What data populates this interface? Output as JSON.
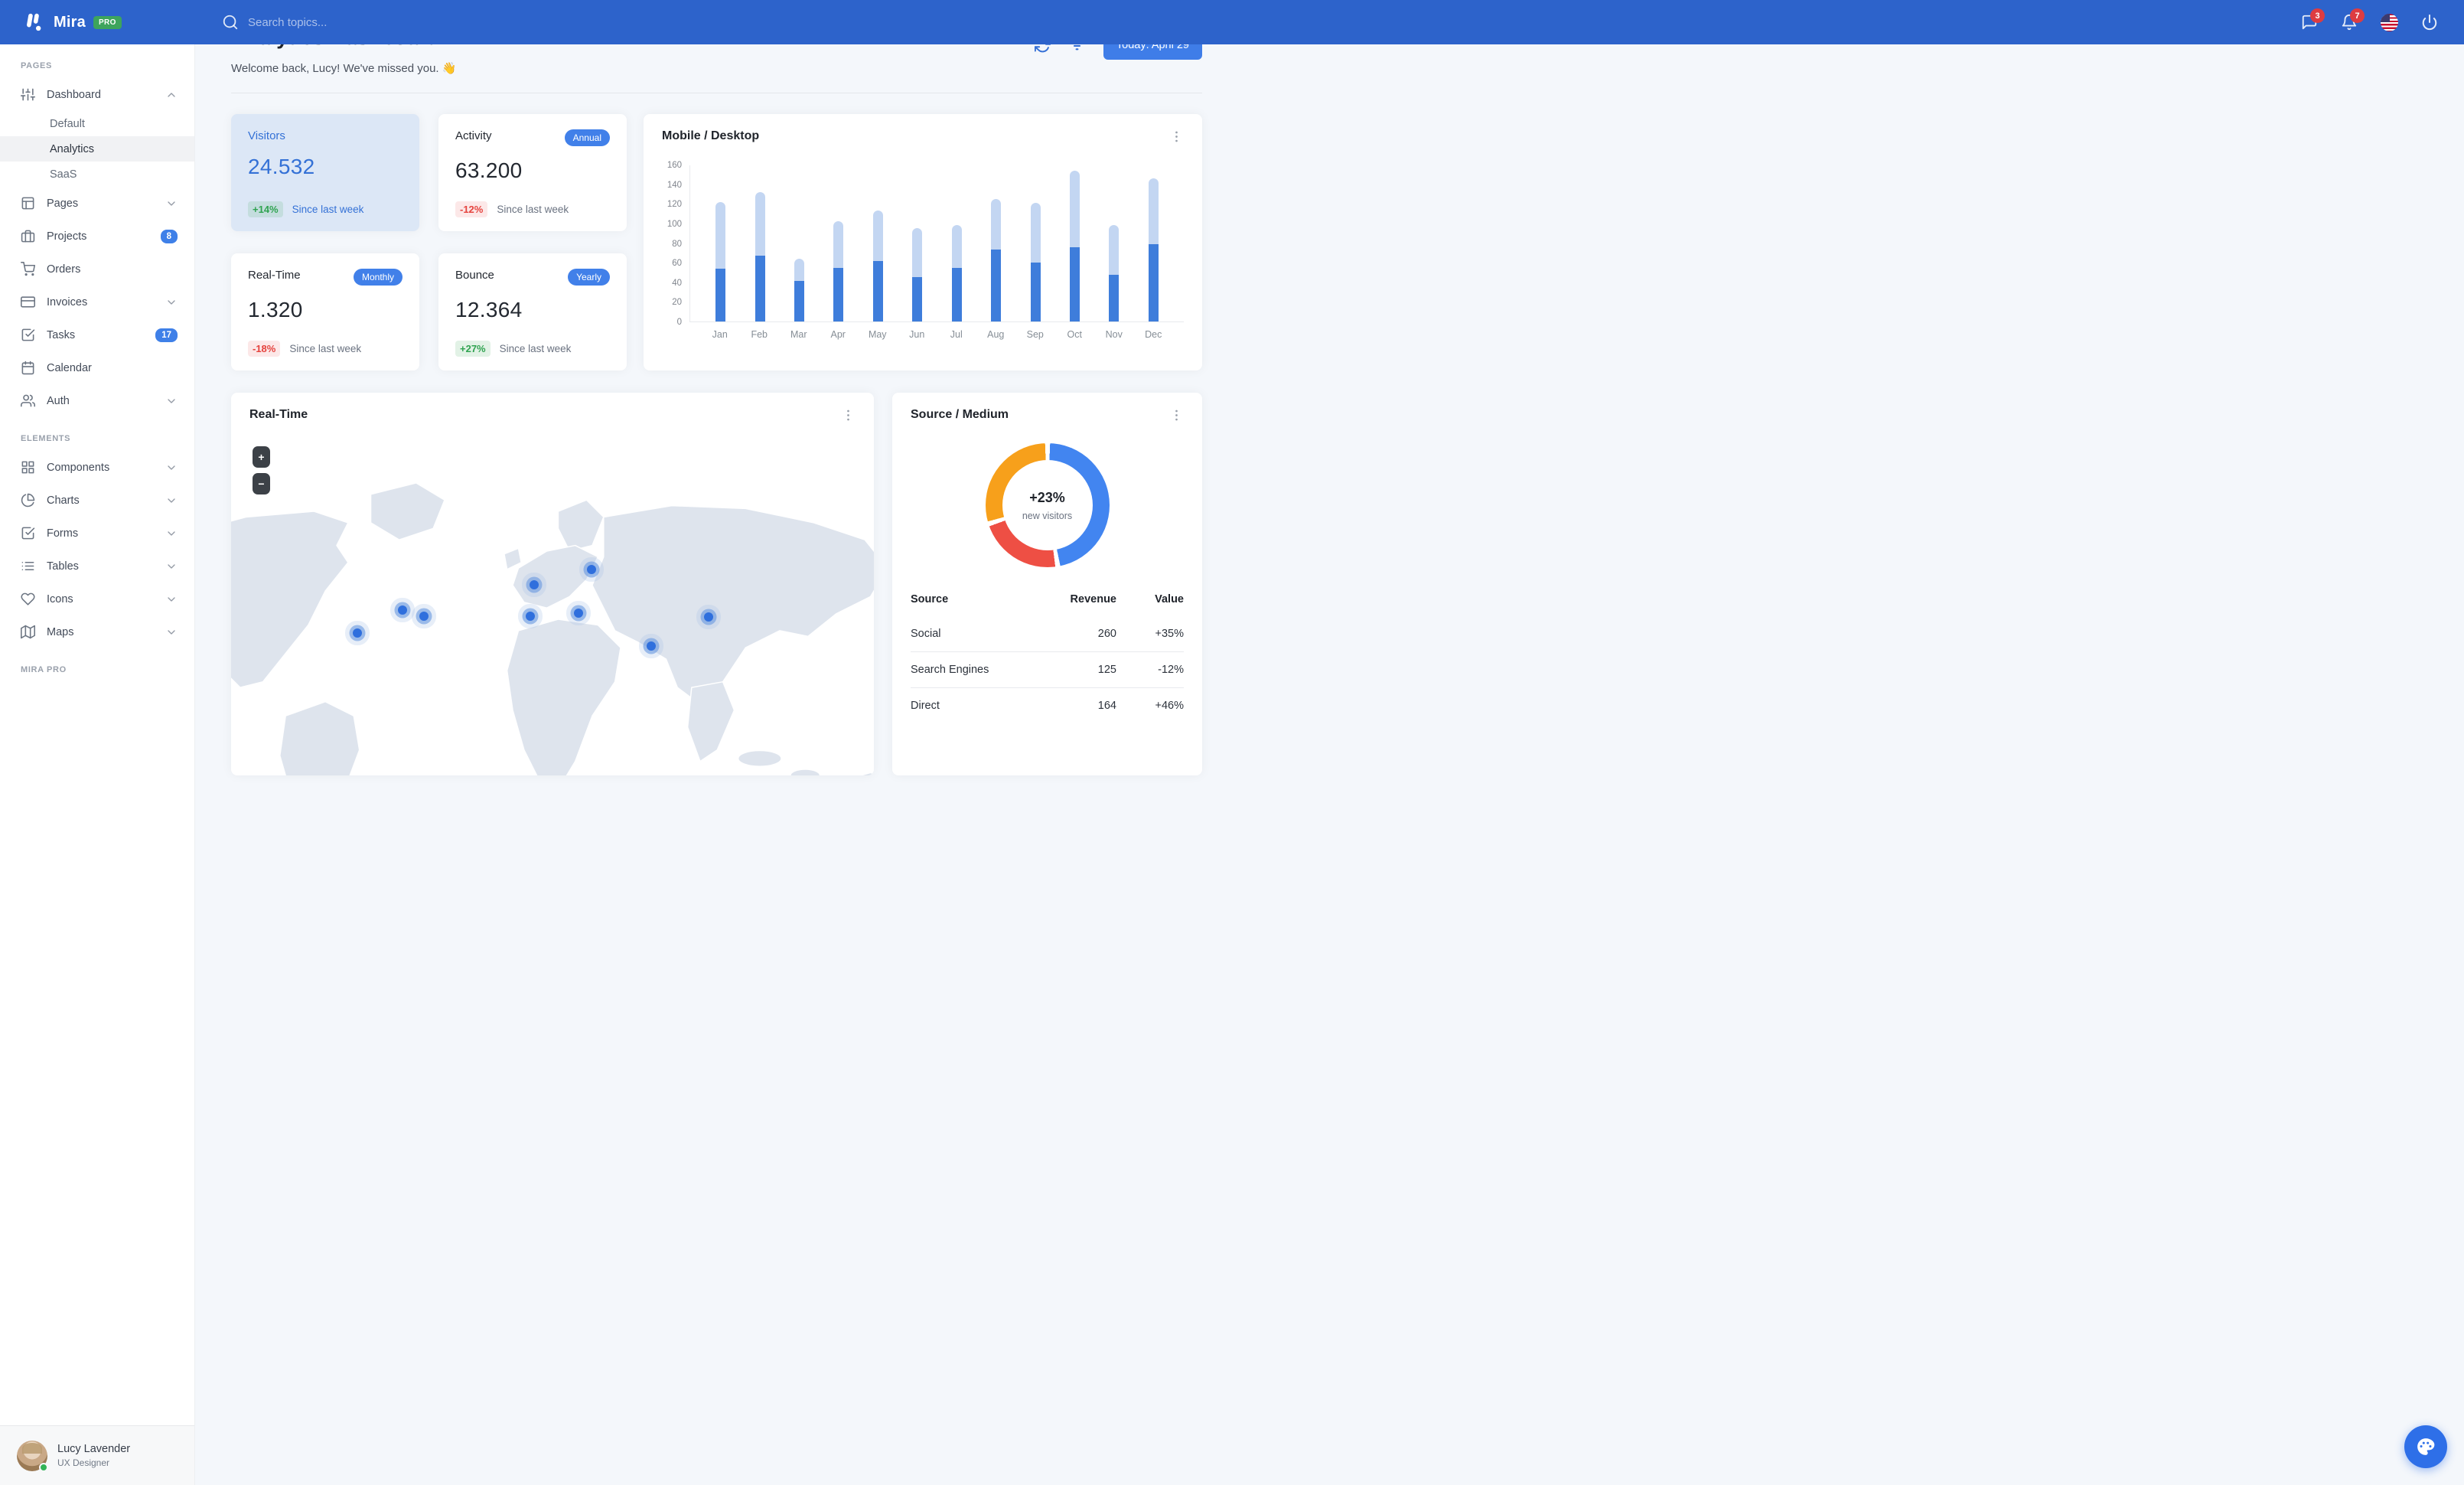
{
  "colors": {
    "navbar": "#2d63cb",
    "accent": "#3b7ddd",
    "primary_button": "#3f7de8",
    "bar_mobile": "#3e7ddb",
    "bar_desktop": "#c3d6f2",
    "donut_blue": "#4285f0",
    "donut_red": "#ee4f44",
    "donut_orange": "#f7a01b",
    "green": "#3cb05d",
    "red": "#ee5244",
    "badge_red": "#dd3c41",
    "pro_green": "#3da45c"
  },
  "navbar": {
    "brand": "Mira",
    "brand_badge": "PRO",
    "search_placeholder": "Search topics...",
    "messages_badge": "3",
    "notifications_badge": "7"
  },
  "sidebar": {
    "sections": [
      {
        "label": "PAGES",
        "items": [
          {
            "icon": "sliders-icon",
            "label": "Dashboard",
            "chevron": "up",
            "children": [
              {
                "label": "Default",
                "active": false
              },
              {
                "label": "Analytics",
                "active": true
              },
              {
                "label": "SaaS",
                "active": false
              }
            ]
          },
          {
            "icon": "layout-icon",
            "label": "Pages",
            "chevron": "down"
          },
          {
            "icon": "briefcase-icon",
            "label": "Projects",
            "badge": "8"
          },
          {
            "icon": "cart-icon",
            "label": "Orders"
          },
          {
            "icon": "credit-card-icon",
            "label": "Invoices",
            "chevron": "down"
          },
          {
            "icon": "check-square-icon",
            "label": "Tasks",
            "badge": "17"
          },
          {
            "icon": "calendar-icon",
            "label": "Calendar"
          },
          {
            "icon": "users-icon",
            "label": "Auth",
            "chevron": "down"
          }
        ]
      },
      {
        "label": "ELEMENTS",
        "items": [
          {
            "icon": "grid-icon",
            "label": "Components",
            "chevron": "down"
          },
          {
            "icon": "pie-chart-icon",
            "label": "Charts",
            "chevron": "down"
          },
          {
            "icon": "check-square-icon",
            "label": "Forms",
            "chevron": "down"
          },
          {
            "icon": "list-icon",
            "label": "Tables",
            "chevron": "down"
          },
          {
            "icon": "heart-icon",
            "label": "Icons",
            "chevron": "down"
          },
          {
            "icon": "map-icon",
            "label": "Maps",
            "chevron": "down"
          }
        ]
      },
      {
        "label": "MIRA PRO",
        "items": []
      }
    ]
  },
  "user": {
    "name": "Lucy Lavender",
    "role": "UX Designer",
    "status": "online"
  },
  "header": {
    "title": "Analytics Dashboard",
    "subtitle": "Welcome back, Lucy! We've missed you. 👋",
    "date_button": "Today: April 29"
  },
  "stats": [
    {
      "title": "Visitors",
      "pill": "",
      "value": "24.532",
      "delta": "+14%",
      "delta_dir": "up",
      "note": "Since last week",
      "variant": "primary"
    },
    {
      "title": "Activity",
      "pill": "Annual",
      "value": "63.200",
      "delta": "-12%",
      "delta_dir": "down",
      "note": "Since last week",
      "variant": ""
    },
    {
      "title": "Real-Time",
      "pill": "Monthly",
      "value": "1.320",
      "delta": "-18%",
      "delta_dir": "down",
      "note": "Since last week",
      "variant": ""
    },
    {
      "title": "Bounce",
      "pill": "Yearly",
      "value": "12.364",
      "delta": "+27%",
      "delta_dir": "up",
      "note": "Since last week",
      "variant": ""
    }
  ],
  "bar_card": {
    "title": "Mobile / Desktop"
  },
  "map_card": {
    "title": "Real-Time",
    "zoom_in": "+",
    "zoom_out": "−",
    "markers": [
      {
        "name": "san-francisco",
        "x": 19.6,
        "y": 44.0
      },
      {
        "name": "chicago",
        "x": 26.7,
        "y": 38.6
      },
      {
        "name": "new-york",
        "x": 30.0,
        "y": 40.0
      },
      {
        "name": "london",
        "x": 47.1,
        "y": 32.8
      },
      {
        "name": "madrid",
        "x": 46.5,
        "y": 40.0
      },
      {
        "name": "rome",
        "x": 54.1,
        "y": 39.4
      },
      {
        "name": "moscow",
        "x": 56.1,
        "y": 29.3
      },
      {
        "name": "delhi",
        "x": 65.3,
        "y": 47.0
      },
      {
        "name": "beijing",
        "x": 74.3,
        "y": 40.3
      }
    ]
  },
  "source_card": {
    "title": "Source / Medium",
    "center": "+23%",
    "center_sub": "new visitors",
    "table": {
      "headers": [
        "Source",
        "Revenue",
        "Value"
      ],
      "rows": [
        {
          "source": "Social",
          "revenue": "260",
          "value": "+35%",
          "trend": "up"
        },
        {
          "source": "Search Engines",
          "revenue": "125",
          "value": "-12%",
          "trend": "down"
        },
        {
          "source": "Direct",
          "revenue": "164",
          "value": "+46%",
          "trend": "up"
        }
      ]
    }
  },
  "chart_data": [
    {
      "type": "bar",
      "stacked": true,
      "title": "Mobile / Desktop",
      "categories": [
        "Jan",
        "Feb",
        "Mar",
        "Apr",
        "May",
        "Jun",
        "Jul",
        "Aug",
        "Sep",
        "Oct",
        "Nov",
        "Dec"
      ],
      "series": [
        {
          "name": "Mobile",
          "color": "#3e7ddb",
          "values": [
            54,
            67,
            41,
            55,
            62,
            45,
            55,
            73,
            60,
            76,
            48,
            79
          ]
        },
        {
          "name": "Desktop",
          "color": "#c3d6f2",
          "values": [
            68,
            65,
            23,
            47,
            51,
            50,
            43,
            52,
            61,
            78,
            50,
            67
          ]
        }
      ],
      "ylabel": "",
      "xlabel": "",
      "ylim": [
        0,
        160
      ],
      "yticks": [
        0,
        20,
        40,
        60,
        80,
        100,
        120,
        140,
        160
      ],
      "grid": false,
      "legend": "none"
    },
    {
      "type": "pie",
      "title": "Source / Medium",
      "donut": true,
      "center_label": "+23%",
      "center_sublabel": "new visitors",
      "slices": [
        {
          "label": "Social",
          "value": 260,
          "color": "#4285f0"
        },
        {
          "label": "Search Engines",
          "value": 125,
          "color": "#ee4f44"
        },
        {
          "label": "Direct",
          "value": 164,
          "color": "#f7a01b"
        }
      ],
      "legend": "none"
    }
  ]
}
